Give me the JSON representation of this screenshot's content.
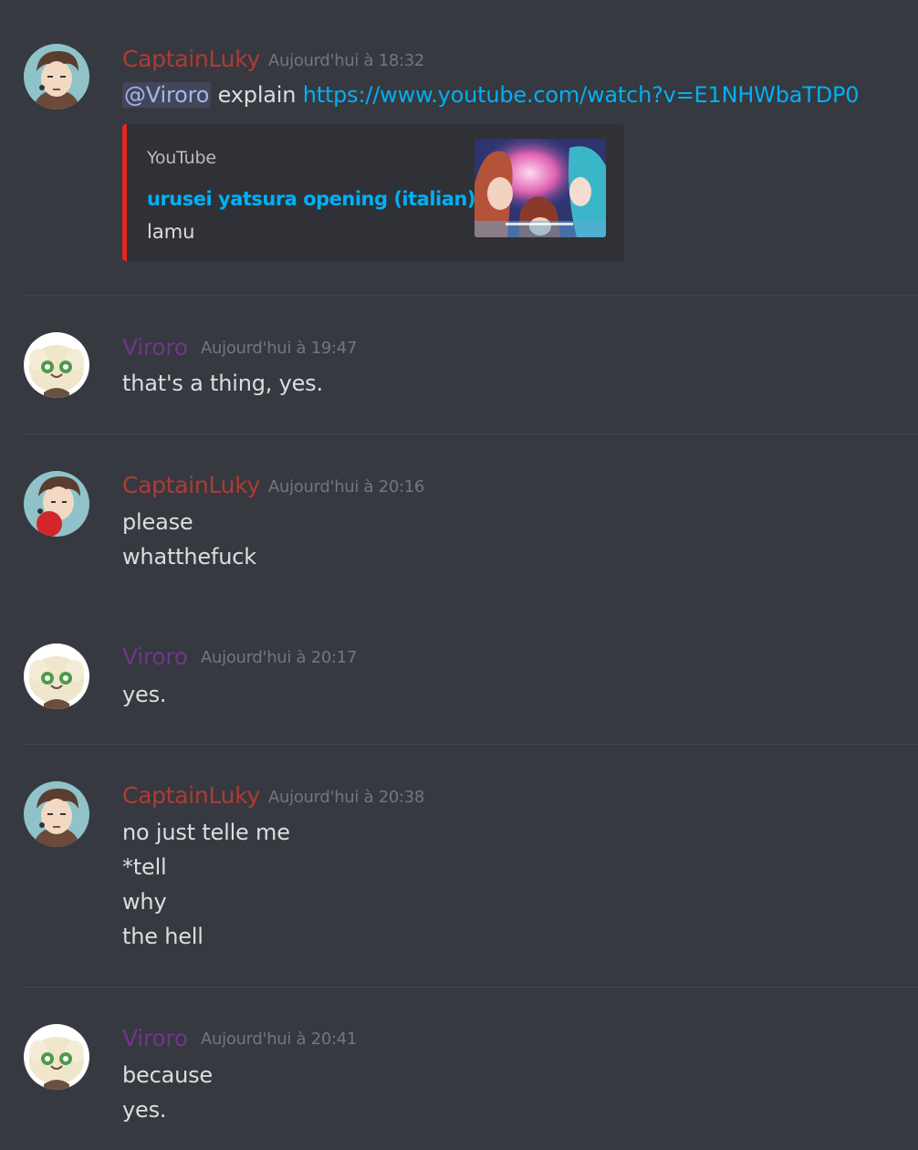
{
  "colors": {
    "background": "#36393f",
    "captainluky": "#b03a36",
    "viroro": "#71368a",
    "link": "#00b0f4",
    "embed_border": "#e3261e"
  },
  "messages": [
    {
      "author": "CaptainLuky",
      "timestamp": "Aujourd'hui à 18:32",
      "avatar": "captainluky-avatar",
      "lines": [],
      "mention": "@Viroro",
      "text_after_mention": " explain ",
      "link": "https://www.youtube.com/watch?v=E1NHWbaTDP0",
      "embed": {
        "provider": "YouTube",
        "title": "urusei yatsura opening (italian)",
        "description": "lamu",
        "thumbnail": "anime-thumbnail"
      }
    },
    {
      "author": "Viroro",
      "timestamp": "Aujourd'hui à 19:47",
      "avatar": "viroro-avatar",
      "lines": [
        "that's a thing, yes."
      ]
    },
    {
      "author": "CaptainLuky",
      "timestamp": "Aujourd'hui à 20:16",
      "avatar": "captainluky-avatar-red",
      "lines": [
        "please",
        "whatthefuck"
      ]
    },
    {
      "author": "Viroro",
      "timestamp": "Aujourd'hui à 20:17",
      "avatar": "viroro-avatar",
      "lines": [
        "yes."
      ]
    },
    {
      "author": "CaptainLuky",
      "timestamp": "Aujourd'hui à 20:38",
      "avatar": "captainluky-avatar",
      "lines": [
        "no just telle me",
        "*tell",
        "why",
        "the hell"
      ]
    },
    {
      "author": "Viroro",
      "timestamp": "Aujourd'hui à 20:41",
      "avatar": "viroro-avatar",
      "lines": [
        "because",
        "yes."
      ]
    }
  ]
}
